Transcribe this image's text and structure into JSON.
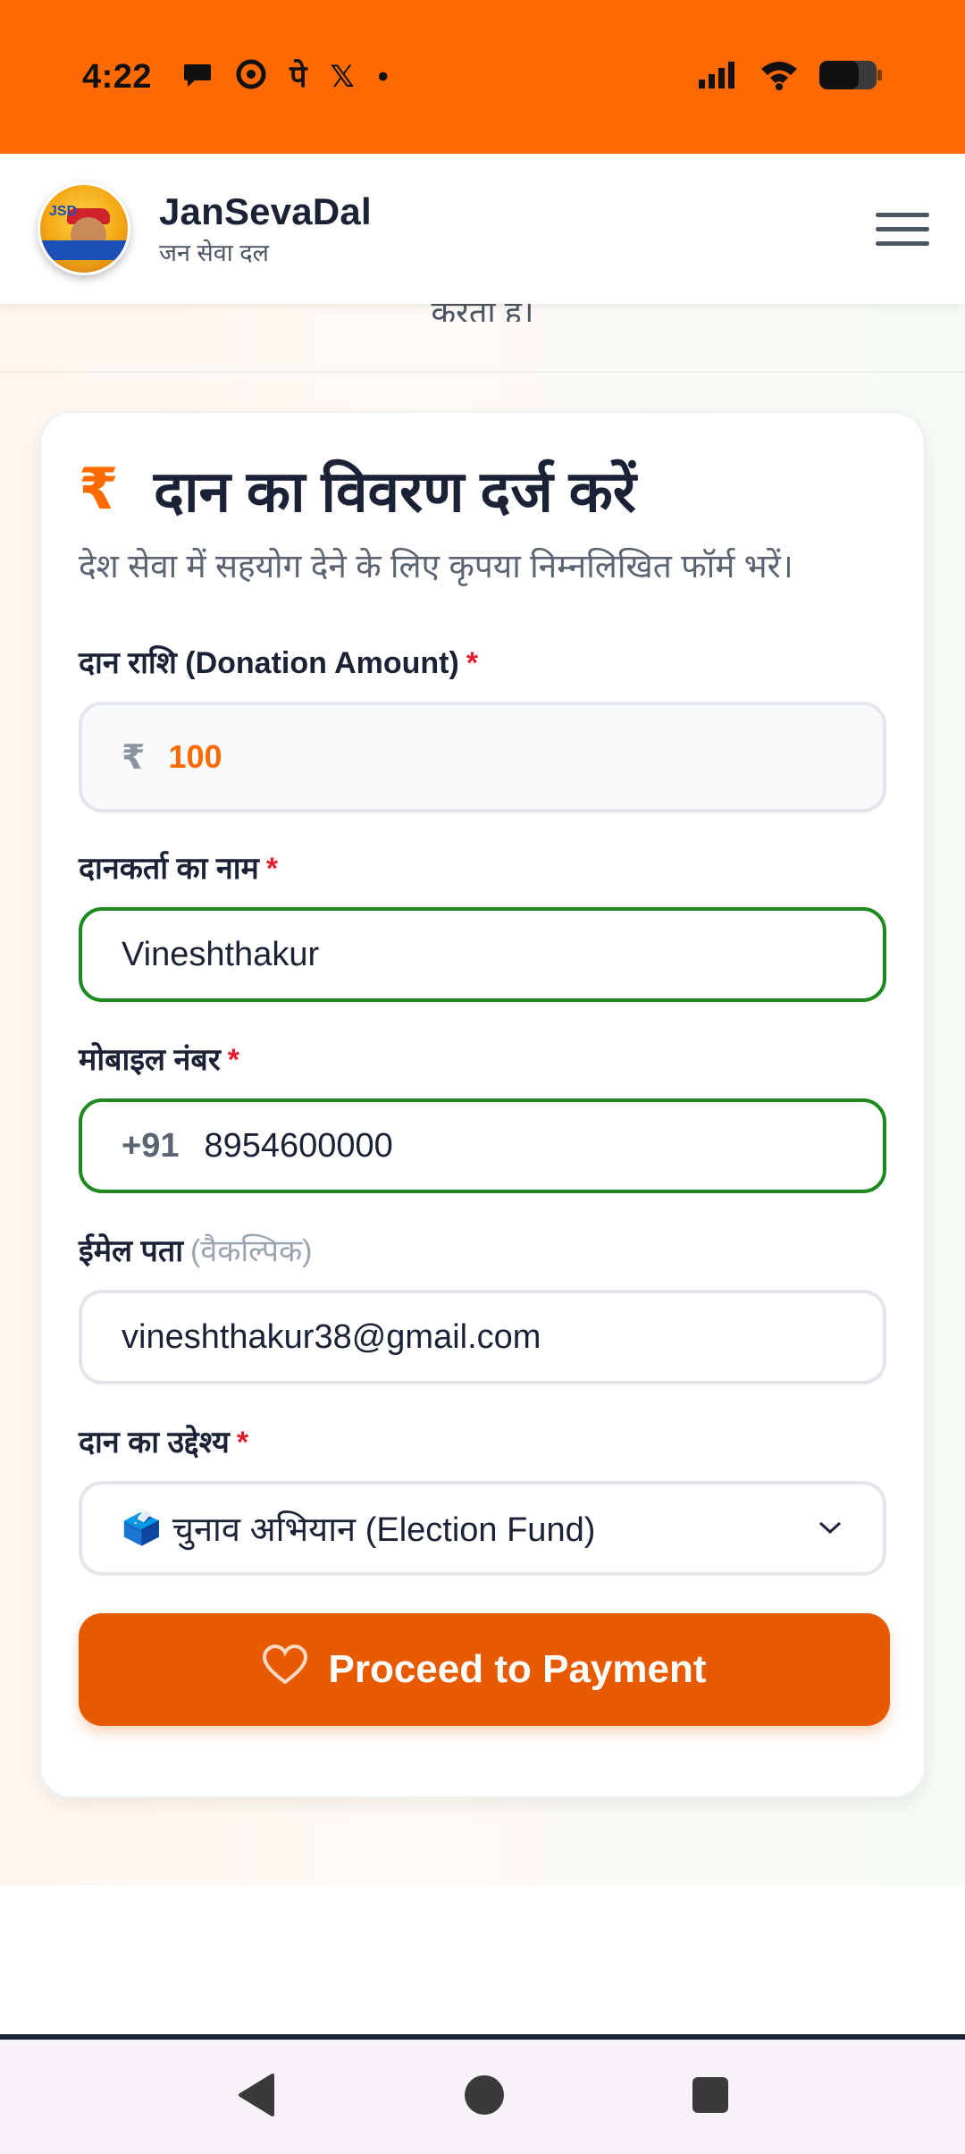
{
  "status_bar": {
    "time": "4:22",
    "icons": [
      "chat-bubble-icon",
      "chrome-icon",
      "pe-icon",
      "x-icon",
      "dot-icon"
    ],
    "pe_glyph": "पे",
    "x_glyph": "𝕏",
    "dot_glyph": "•",
    "right_icons": [
      "signal-icon",
      "wifi-icon",
      "battery-icon"
    ]
  },
  "header": {
    "logo_letters": "JSD",
    "title": "JanSevaDal",
    "subtitle": "जन सेवा दल"
  },
  "page": {
    "partial_text": "करता है।"
  },
  "form": {
    "title": "दान का विवरण दर्ज करें",
    "rupee_symbol": "₹",
    "description": "देश सेवा में सहयोग देने के लिए कृपया निम्नलिखित फॉर्म भरें।",
    "amount": {
      "label": "दान राशि (Donation Amount)",
      "required": "*",
      "symbol": "₹",
      "value": "100"
    },
    "name": {
      "label": "दानकर्ता का नाम",
      "required": "*",
      "value": "Vineshthakur"
    },
    "mobile": {
      "label": "मोबाइल नंबर",
      "required": "*",
      "prefix": "+91",
      "value": "8954600000"
    },
    "email": {
      "label": "ईमेल पता",
      "optional": "(वैकल्पिक)",
      "value": "vineshthakur38@gmail.com"
    },
    "purpose": {
      "label": "दान का उद्देश्य",
      "required": "*",
      "icon": "🗳️",
      "value": "चुनाव अभियान (Election Fund)"
    },
    "submit_label": "Proceed to Payment"
  },
  "colors": {
    "status_bar": "#ff6a00",
    "accent": "#ff6a00",
    "button": "#e85a00",
    "valid_border": "#1e8a1e",
    "required": "#e11d2e"
  }
}
